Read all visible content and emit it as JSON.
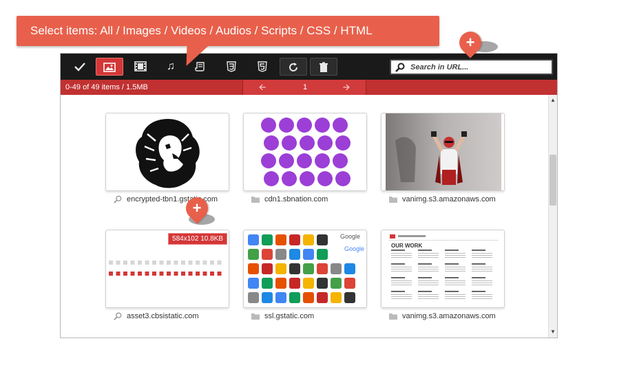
{
  "callout": {
    "text": "Select items: All / Images / Videos / Audios / Scripts / CSS / HTML"
  },
  "toolbar": {
    "buttons": [
      {
        "name": "select-all-button",
        "icon": "check-icon"
      },
      {
        "name": "filter-images-button",
        "icon": "image-icon"
      },
      {
        "name": "filter-videos-button",
        "icon": "film-icon"
      },
      {
        "name": "filter-audios-button",
        "icon": "music-note-icon"
      },
      {
        "name": "filter-scripts-button",
        "icon": "script-icon"
      },
      {
        "name": "filter-css-button",
        "icon": "css3-icon"
      },
      {
        "name": "filter-html-button",
        "icon": "html5-icon"
      },
      {
        "name": "refresh-button",
        "icon": "refresh-icon"
      },
      {
        "name": "clear-button",
        "icon": "trash-icon"
      }
    ],
    "search_placeholder": "Search in URL..."
  },
  "status": {
    "count": "0-49 of 49 items / 1.5MB",
    "page": "1"
  },
  "items": [
    {
      "caption": "encrypted-tbn1.gstatic.com"
    },
    {
      "caption": "cdn1.sbnation.com"
    },
    {
      "caption": "vanimg.s3.amazonaws.com"
    },
    {
      "caption": "asset3.cbsistatic.com",
      "badge": "584x102 10.8KB"
    },
    {
      "caption": "ssl.gstatic.com"
    },
    {
      "caption": "vanimg.s3.amazonaws.com"
    }
  ],
  "thumb_texts": {
    "doc_title": "OUR WORK",
    "brand": "Google"
  },
  "colors": {
    "accent": "#e8604b",
    "toolbar": "#1a1a1a",
    "status": "#c13131",
    "sticker": "#9b3fd6"
  }
}
